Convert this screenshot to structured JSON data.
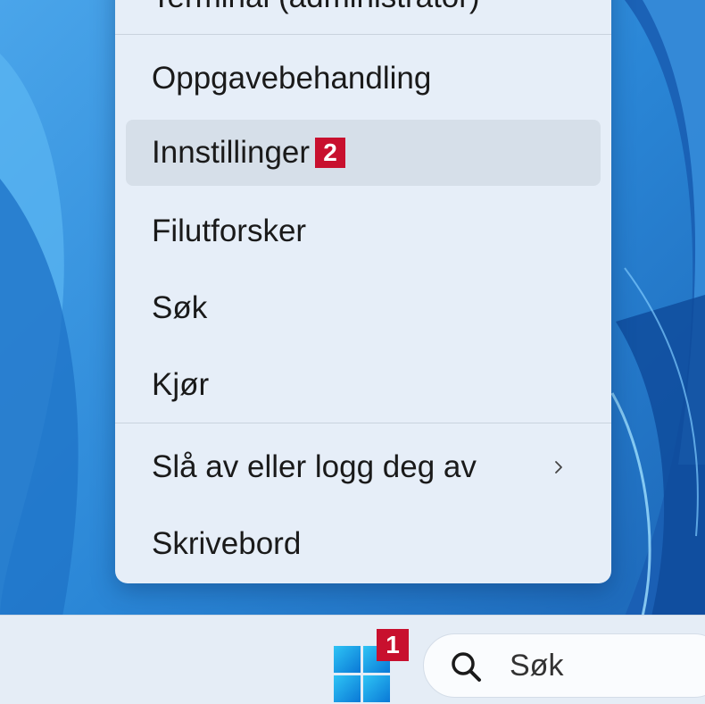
{
  "menu": {
    "items": [
      {
        "label": "Terminal (administrator)"
      },
      {
        "label": "Oppgavebehandling"
      },
      {
        "label": "Innstillinger"
      },
      {
        "label": "Filutforsker"
      },
      {
        "label": "Søk"
      },
      {
        "label": "Kjør"
      },
      {
        "label": "Slå av eller logg deg av"
      },
      {
        "label": "Skrivebord"
      }
    ],
    "hovered_item": "Innstillinger",
    "submenu_icon": "chevron-right-icon"
  },
  "badges": {
    "start": "1",
    "settings": "2",
    "color": "#c8102e"
  },
  "taskbar": {
    "start_icon": "windows-logo-icon",
    "search": {
      "icon": "search-icon",
      "text": "Søk"
    }
  },
  "colors": {
    "accent": "#0f6cbd",
    "menu_bg": "#e6eef8"
  }
}
